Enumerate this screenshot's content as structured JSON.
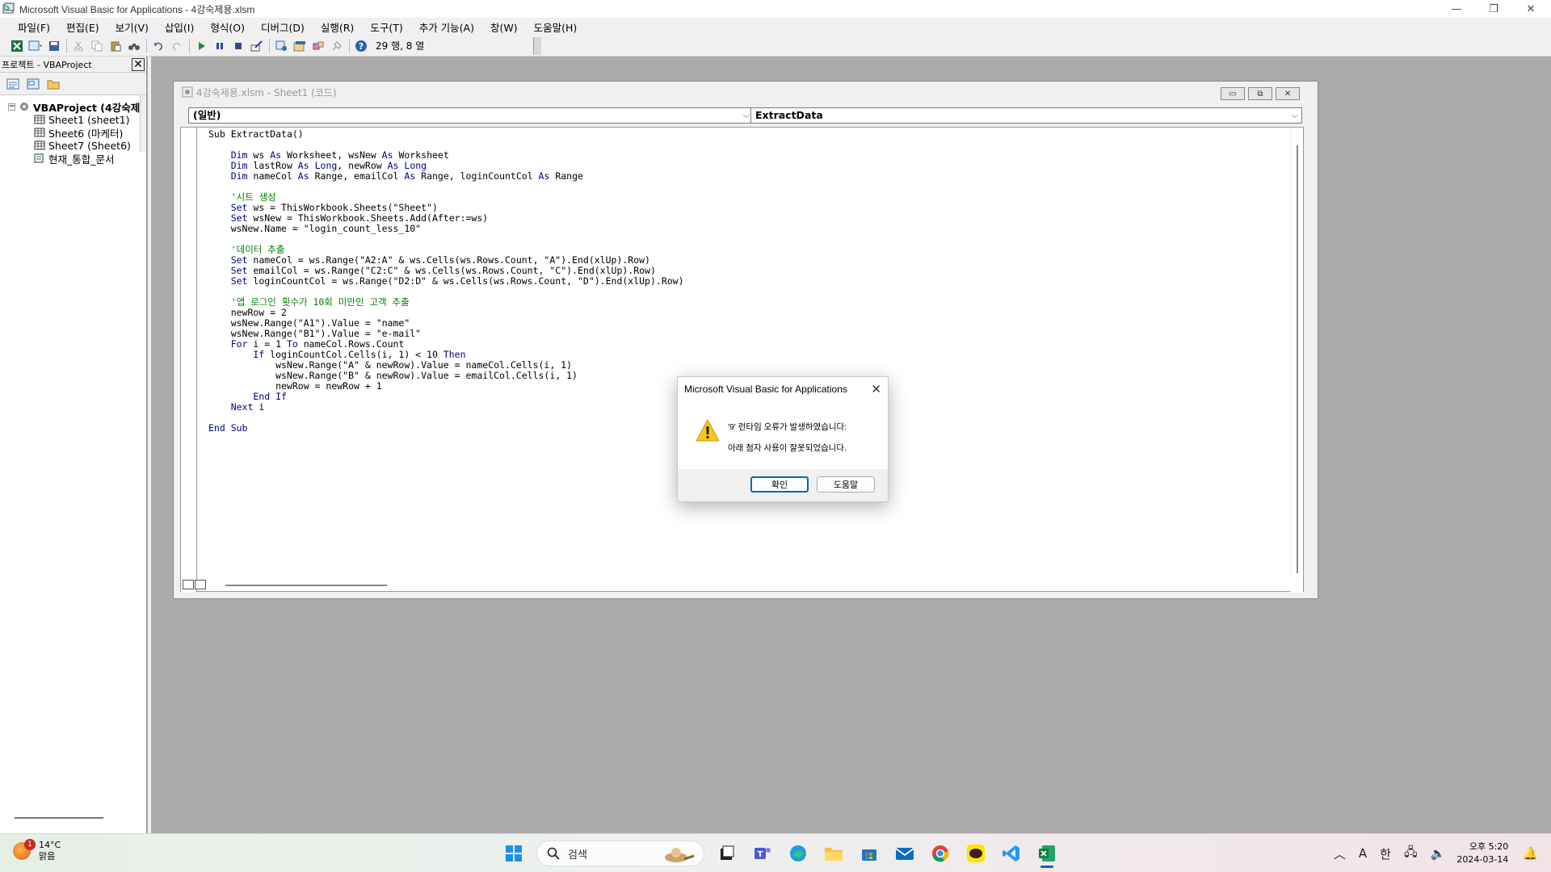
{
  "window": {
    "title": "Microsoft Visual Basic for Applications - 4강숙제용.xlsm",
    "controls": {
      "minimize": "—",
      "restore": "❐",
      "close": "✕"
    }
  },
  "menu": [
    "파일(F)",
    "편집(E)",
    "보기(V)",
    "삽입(I)",
    "형식(O)",
    "디버그(D)",
    "실행(R)",
    "도구(T)",
    "추가 기능(A)",
    "창(W)",
    "도움말(H)"
  ],
  "toolbar": {
    "cursor_position": "29 행, 8 열"
  },
  "project": {
    "header": "프로젝트 - VBAProject",
    "root": "VBAProject (4강숙제",
    "items": [
      "Sheet1 (sheet1)",
      "Sheet6 (마케터)",
      "Sheet7 (Sheet6)",
      "현재_통합_문서"
    ]
  },
  "code_window": {
    "title": "4강숙제용.xlsm - Sheet1 (코드)",
    "object_combo": "(일반)",
    "procedure_combo": "ExtractData",
    "lines": [
      [
        [
          "",
          "Sub"
        ],
        [
          "",
          " ExtractData()"
        ]
      ],
      [],
      [
        [
          "",
          "    "
        ],
        [
          "kw",
          "Dim"
        ],
        [
          "",
          " ws "
        ],
        [
          "kw",
          "As"
        ],
        [
          "",
          " Worksheet, wsNew "
        ],
        [
          "kw",
          "As"
        ],
        [
          "",
          " Worksheet"
        ]
      ],
      [
        [
          "",
          "    "
        ],
        [
          "kw",
          "Dim"
        ],
        [
          "",
          " lastRow "
        ],
        [
          "kw",
          "As"
        ],
        [
          "",
          " "
        ],
        [
          "kw",
          "Long"
        ],
        [
          "",
          ", newRow "
        ],
        [
          "kw",
          "As"
        ],
        [
          "",
          " "
        ],
        [
          "kw",
          "Long"
        ]
      ],
      [
        [
          "",
          "    "
        ],
        [
          "kw",
          "Dim"
        ],
        [
          "",
          " nameCol "
        ],
        [
          "kw",
          "As"
        ],
        [
          "",
          " Range, emailCol "
        ],
        [
          "kw",
          "As"
        ],
        [
          "",
          " Range, loginCountCol "
        ],
        [
          "kw",
          "As"
        ],
        [
          "",
          " Range"
        ]
      ],
      [],
      [
        [
          "",
          "    "
        ],
        [
          "cm",
          "'시트 생성"
        ]
      ],
      [
        [
          "",
          "    "
        ],
        [
          "kw",
          "Set"
        ],
        [
          "",
          " ws = ThisWorkbook.Sheets(\"Sheet\")"
        ]
      ],
      [
        [
          "",
          "    "
        ],
        [
          "kw",
          "Set"
        ],
        [
          "",
          " wsNew = ThisWorkbook.Sheets.Add(After:=ws)"
        ]
      ],
      [
        [
          "",
          "    wsNew.Name = \"login_count_less_10\""
        ]
      ],
      [],
      [
        [
          "",
          "    "
        ],
        [
          "cm",
          "'데이터 추출"
        ]
      ],
      [
        [
          "",
          "    "
        ],
        [
          "kw",
          "Set"
        ],
        [
          "",
          " nameCol = ws.Range(\"A2:A\" & ws.Cells(ws.Rows.Count, \"A\").End(xlUp).Row)"
        ]
      ],
      [
        [
          "",
          "    "
        ],
        [
          "kw",
          "Set"
        ],
        [
          "",
          " emailCol = ws.Range(\"C2:C\" & ws.Cells(ws.Rows.Count, \"C\").End(xlUp).Row)"
        ]
      ],
      [
        [
          "",
          "    "
        ],
        [
          "kw",
          "Set"
        ],
        [
          "",
          " loginCountCol = ws.Range(\"D2:D\" & ws.Cells(ws.Rows.Count, \"D\").End(xlUp).Row)"
        ]
      ],
      [],
      [
        [
          "",
          "    "
        ],
        [
          "cm",
          "'앱 로그인 횟수가 10회 미만인 고객 추출"
        ]
      ],
      [
        [
          "",
          "    newRow = 2"
        ]
      ],
      [
        [
          "",
          "    wsNew.Range(\"A1\").Value = \"name\""
        ]
      ],
      [
        [
          "",
          "    wsNew.Range(\"B1\").Value = \"e-mail\""
        ]
      ],
      [
        [
          "",
          "    "
        ],
        [
          "kw",
          "For"
        ],
        [
          "",
          " i = 1 "
        ],
        [
          "kw",
          "To"
        ],
        [
          "",
          " nameCol.Rows.Count"
        ]
      ],
      [
        [
          "",
          "        "
        ],
        [
          "kw",
          "If"
        ],
        [
          "",
          " loginCountCol.Cells(i, 1) < 10 "
        ],
        [
          "kw",
          "Then"
        ]
      ],
      [
        [
          "",
          "            wsNew.Range(\"A\" & newRow).Value = nameCol.Cells(i, 1)"
        ]
      ],
      [
        [
          "",
          "            wsNew.Range(\"B\" & newRow).Value = emailCol.Cells(i, 1)"
        ]
      ],
      [
        [
          "",
          "            newRow = newRow + 1"
        ]
      ],
      [
        [
          "",
          "        "
        ],
        [
          "kw",
          "End If"
        ]
      ],
      [
        [
          "",
          "    "
        ],
        [
          "kw",
          "Next"
        ],
        [
          "",
          " i"
        ]
      ],
      [],
      [
        [
          "kw",
          "End Sub"
        ]
      ]
    ]
  },
  "dialog": {
    "title": "Microsoft Visual Basic for Applications",
    "message_line1": "'9' 런타임 오류가 발생하였습니다:",
    "message_line2": "아래 첨자 사용이 잘못되었습니다.",
    "ok_label": "확인",
    "help_label": "도움말",
    "close": "✕"
  },
  "taskbar": {
    "weather_badge": "1",
    "temperature": "14°C",
    "condition": "맑음",
    "search_placeholder": "검색",
    "time": "오후 5:20",
    "date": "2024-03-14",
    "ime_a": "A",
    "ime_lang": "한"
  },
  "colors": {
    "keyword": "#00008b",
    "comment": "#008000",
    "accent": "#0067c0"
  }
}
